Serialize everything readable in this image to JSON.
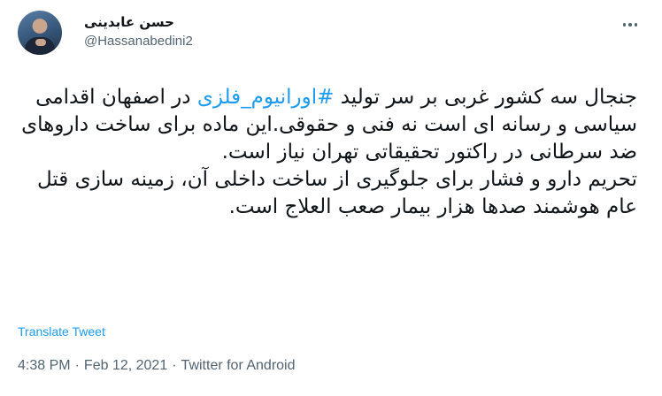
{
  "author": {
    "display_name": "حسن عابدینی",
    "handle": "@Hassanabedini2"
  },
  "tweet": {
    "line1_pre": "جنجال سه کشور غربی بر سر تولید ",
    "hashtag": "#اورانیوم_فلزی",
    "line1_post": " در اصفهان اقدامی سیاسی و رسانه ای است نه فنی و حقوقی.این ماده برای ساخت داروهای ضد سرطانی در راکتور تحقیقاتی تهران نیاز است.",
    "paragraph2": "تحریم دارو و فشار برای جلوگیری از ساخت داخلی آن، زمینه سازی  قتل عام هوشمند صدها هزار بیمار صعب العلاج است."
  },
  "translate_label": "Translate Tweet",
  "meta": {
    "time": "4:38 PM",
    "date": "Feb 12, 2021",
    "source": "Twitter for Android",
    "separator": "·"
  },
  "colors": {
    "accent": "#1d9bf0",
    "secondary_text": "#536471",
    "primary_text": "#0f1419"
  },
  "icons": {
    "more": "more-horizontal-icon"
  }
}
